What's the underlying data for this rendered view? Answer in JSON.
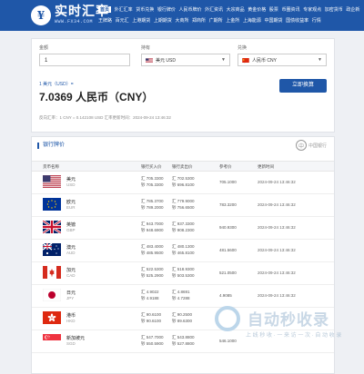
{
  "header": {
    "logo_title": "实时汇率",
    "logo_sub": "WWW.FX34.COM",
    "nav_row1": [
      "首页",
      "外汇汇率",
      "货币兑换",
      "银行牌价",
      "人民币牌价",
      "外汇资讯",
      "大宗商品",
      "黄金价格",
      "股票",
      "币圈资讯",
      "专家观点",
      "加密货币",
      "政企新"
    ],
    "nav_row2": [
      "王牌路",
      "百元汇",
      "上港期货",
      "上期期货",
      "大商所",
      "郑商所",
      "广期所",
      "上金所",
      "上海能源",
      "中国期货",
      "国债收益率",
      "行情"
    ]
  },
  "converter": {
    "amount_label": "金额",
    "amount_value": "1",
    "from_label": "持有",
    "from_value": "美元 USD",
    "to_label": "兑换",
    "to_value": "人民币 CNY",
    "unit_line": "1 美元（USD）=",
    "result": "7.0369 人民币（CNY）",
    "detail": "反向汇率：1 CNY = 0.142108 USD   汇率更新时间：2024-09-24 13:46:32",
    "button": "立即换算"
  },
  "rates": {
    "title": "银行牌价",
    "bank_name": "中国银行",
    "headers": [
      "货币名称",
      "银行买入价",
      "银行卖出价",
      "参考价",
      "更新时间"
    ],
    "rows": [
      {
        "name": "美元",
        "code": "USD",
        "buy1": "汇 705.3300",
        "buy2": "钞 705.3300",
        "sell1": "汇 702.5300",
        "sell2": "钞 696.8100",
        "ref": "705.1000",
        "time": "2024-09-24 13:46:32"
      },
      {
        "name": "欧元",
        "code": "EUR",
        "buy1": "汇 785.3700",
        "buy2": "钞 789.2000",
        "sell1": "汇 779.9000",
        "sell2": "钞 756.6500",
        "ref": "783.3200",
        "time": "2024-09-24 13:46:32"
      },
      {
        "name": "英镑",
        "code": "GBP",
        "buy1": "汇 943.7000",
        "buy2": "钞 948.6900",
        "sell1": "汇 937.3300",
        "sell2": "钞 908.2300",
        "ref": "940.9300",
        "time": "2024-09-24 13:46:32"
      },
      {
        "name": "澳元",
        "code": "AUD",
        "buy1": "汇 483.4000",
        "buy2": "钞 485.9500",
        "sell1": "汇 480.1300",
        "sell2": "钞 465.8100",
        "ref": "481.5600",
        "time": "2024-09-24 13:46:32"
      },
      {
        "name": "加元",
        "code": "CAD",
        "buy1": "汇 522.5300",
        "buy2": "钞 525.2900",
        "sell1": "汇 518.9300",
        "sell2": "钞 503.5300",
        "ref": "521.0500",
        "time": "2024-09-24 13:46:32"
      },
      {
        "name": "日元",
        "code": "JPY",
        "buy1": "汇 4.9022",
        "buy2": "钞 4.9188",
        "sell1": "汇 4.8691",
        "sell2": "钞 4.7288",
        "ref": "4.9085",
        "time": "2024-09-24 13:46:32"
      },
      {
        "name": "港币",
        "code": "HKD",
        "buy1": "汇 90.6100",
        "buy2": "钞 90.6100",
        "sell1": "汇 90.2500",
        "sell2": "钞 89.6300",
        "ref": "",
        "time": ""
      },
      {
        "name": "新加坡元",
        "code": "SGD",
        "buy1": "汇 547.7000",
        "buy2": "钞 550.5900",
        "sell1": "汇 543.8800",
        "sell2": "钞 527.8800",
        "ref": "546.1000",
        "time": ""
      }
    ]
  },
  "watermark": {
    "title": "自动秒收录",
    "sub": "上 线 秒 收 · 一 来 访 一 次 · 自 动 收 录"
  }
}
